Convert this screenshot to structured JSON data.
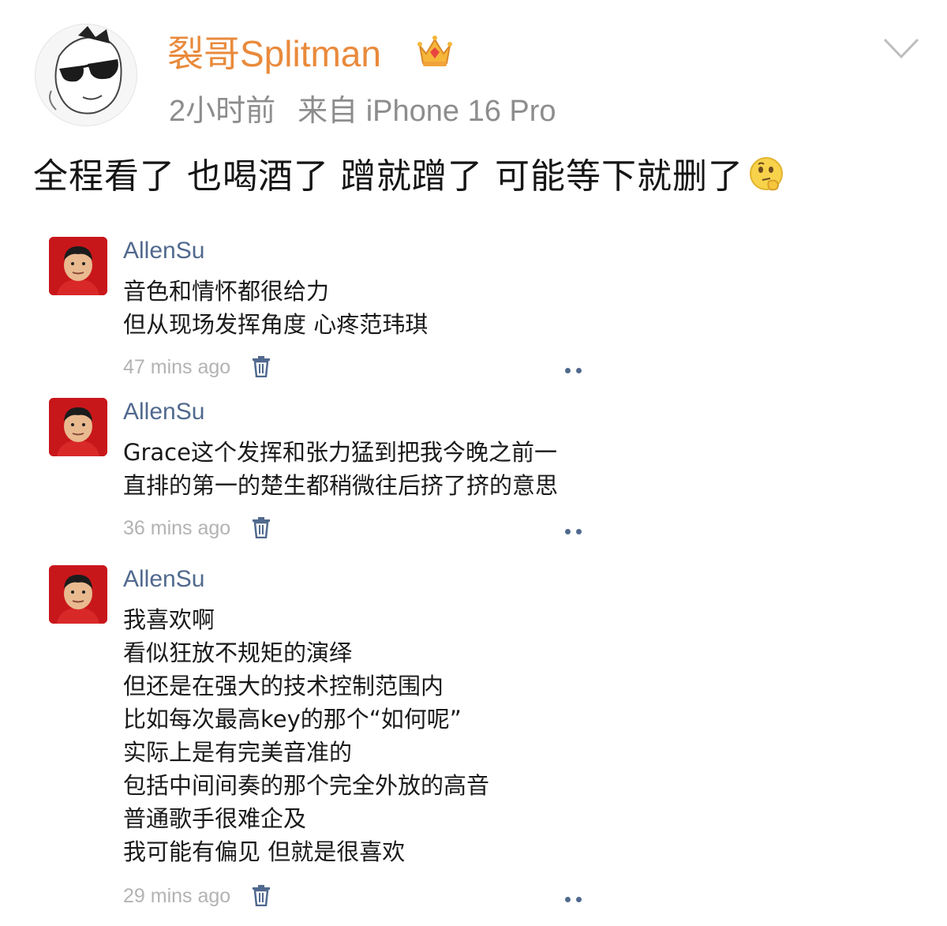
{
  "post": {
    "author": "裂哥Splitman",
    "author_badge_icon": "crown-icon",
    "time": "2小时前",
    "source": "来自 iPhone 16 Pro",
    "text": "全程看了 也喝酒了 蹭就蹭了 可能等下就删了",
    "emoji_icon": "thinking-emoji-icon",
    "author_name_color": "#e98a3c"
  },
  "comments": [
    {
      "name": "AllenSu",
      "lines": [
        "音色和情怀都很给力",
        "但从现场发挥角度 心疼范玮琪"
      ],
      "time": "47 mins ago"
    },
    {
      "name": "AllenSu",
      "lines": [
        "Grace这个发挥和张力猛到把我今晚之前一",
        "直排的第一的楚生都稍微往后挤了挤的意思"
      ],
      "time": "36 mins ago"
    },
    {
      "name": "AllenSu",
      "lines": [
        "我喜欢啊",
        "看似狂放不规矩的演绎",
        "但还是在强大的技术控制范围内",
        "比如每次最高key的那个“如何呢”",
        "实际上是有完美音准的",
        "包括中间间奏的那个完全外放的高音",
        "普通歌手很难企及",
        "我可能有偏见 但就是很喜欢"
      ],
      "time": "29 mins ago"
    }
  ],
  "colors": {
    "comment_name": "#51698e",
    "timestamp": "#b3b3b3",
    "avatar_bg": "#c8171b"
  }
}
